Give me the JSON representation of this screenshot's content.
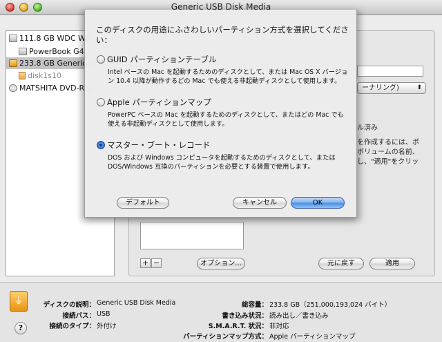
{
  "window": {
    "title": "Generic USB Disk Media"
  },
  "sidebar": {
    "items": [
      {
        "label": "111.8 GB WDC WD",
        "icon": "hard-disk-icon"
      },
      {
        "label": "PowerBook G4",
        "icon": "volume-icon"
      },
      {
        "label": "233.8 GB Generic U",
        "icon": "usb-disk-icon"
      },
      {
        "label": "disk1s10",
        "icon": "partition-icon"
      },
      {
        "label": "MATSHITA DVD-R U",
        "icon": "dvd-drive-icon"
      }
    ]
  },
  "panel": {
    "popup_partial": "ーナリング)",
    "info_partial_1": "ル済み",
    "info_partial_2": "を作成するには、ボ",
    "info_partial_3": "ボリュームの名前、",
    "info_partial_4": "し、\"適用\"をクリッ",
    "add_label": "+",
    "remove_label": "−",
    "options_button": "オプション...",
    "revert_button": "元に戻す",
    "apply_button": "適用"
  },
  "sheet": {
    "prompt": "このディスクの用途にふさわしいパーティション方式を選択してください：",
    "options": [
      {
        "label": "GUID パーティションテーブル",
        "desc": "Intel ベースの Mac を起動するためのディスクとして、または Mac OS X バージョン 10.4 以降が動作するどの Mac でも使える非起動ディスクとして使用します。",
        "selected": false
      },
      {
        "label": "Apple パーティションマップ",
        "desc": "PowerPC ベースの Mac を起動するためのディスクとして、またはどの Mac でも使える非起動ディスクとして使用します。",
        "selected": false
      },
      {
        "label": "マスター・ブート・レコード",
        "desc": "DOS および Windows コンピュータを起動するためのディスクとして、または DOS/Windows 互換のパーティションを必要とする装置で使用します。",
        "selected": true
      }
    ],
    "default_button": "デフォルト",
    "cancel_button": "キャンセル",
    "ok_button": "OK"
  },
  "info": {
    "description_label": "ディスクの説明：",
    "description_value": "Generic USB Disk Media",
    "bus_label": "接続バス：",
    "bus_value": "USB",
    "type_label": "接続のタイプ：",
    "type_value": "外付け",
    "capacity_label": "総容量：",
    "capacity_value": "233.8 GB（251,000,193,024 バイト）",
    "write_label": "書き込み状況：",
    "write_value": "読み出し／書き込み",
    "smart_label": "S.M.A.R.T. 状況：",
    "smart_value": "非対応",
    "partmap_label": "パーティションマップ方式：",
    "partmap_value": "Apple パーティションマップ"
  },
  "colors": {
    "accent": "#4a8fe6",
    "usb_orange": "#e59514",
    "selection": "#c4c4c4"
  }
}
